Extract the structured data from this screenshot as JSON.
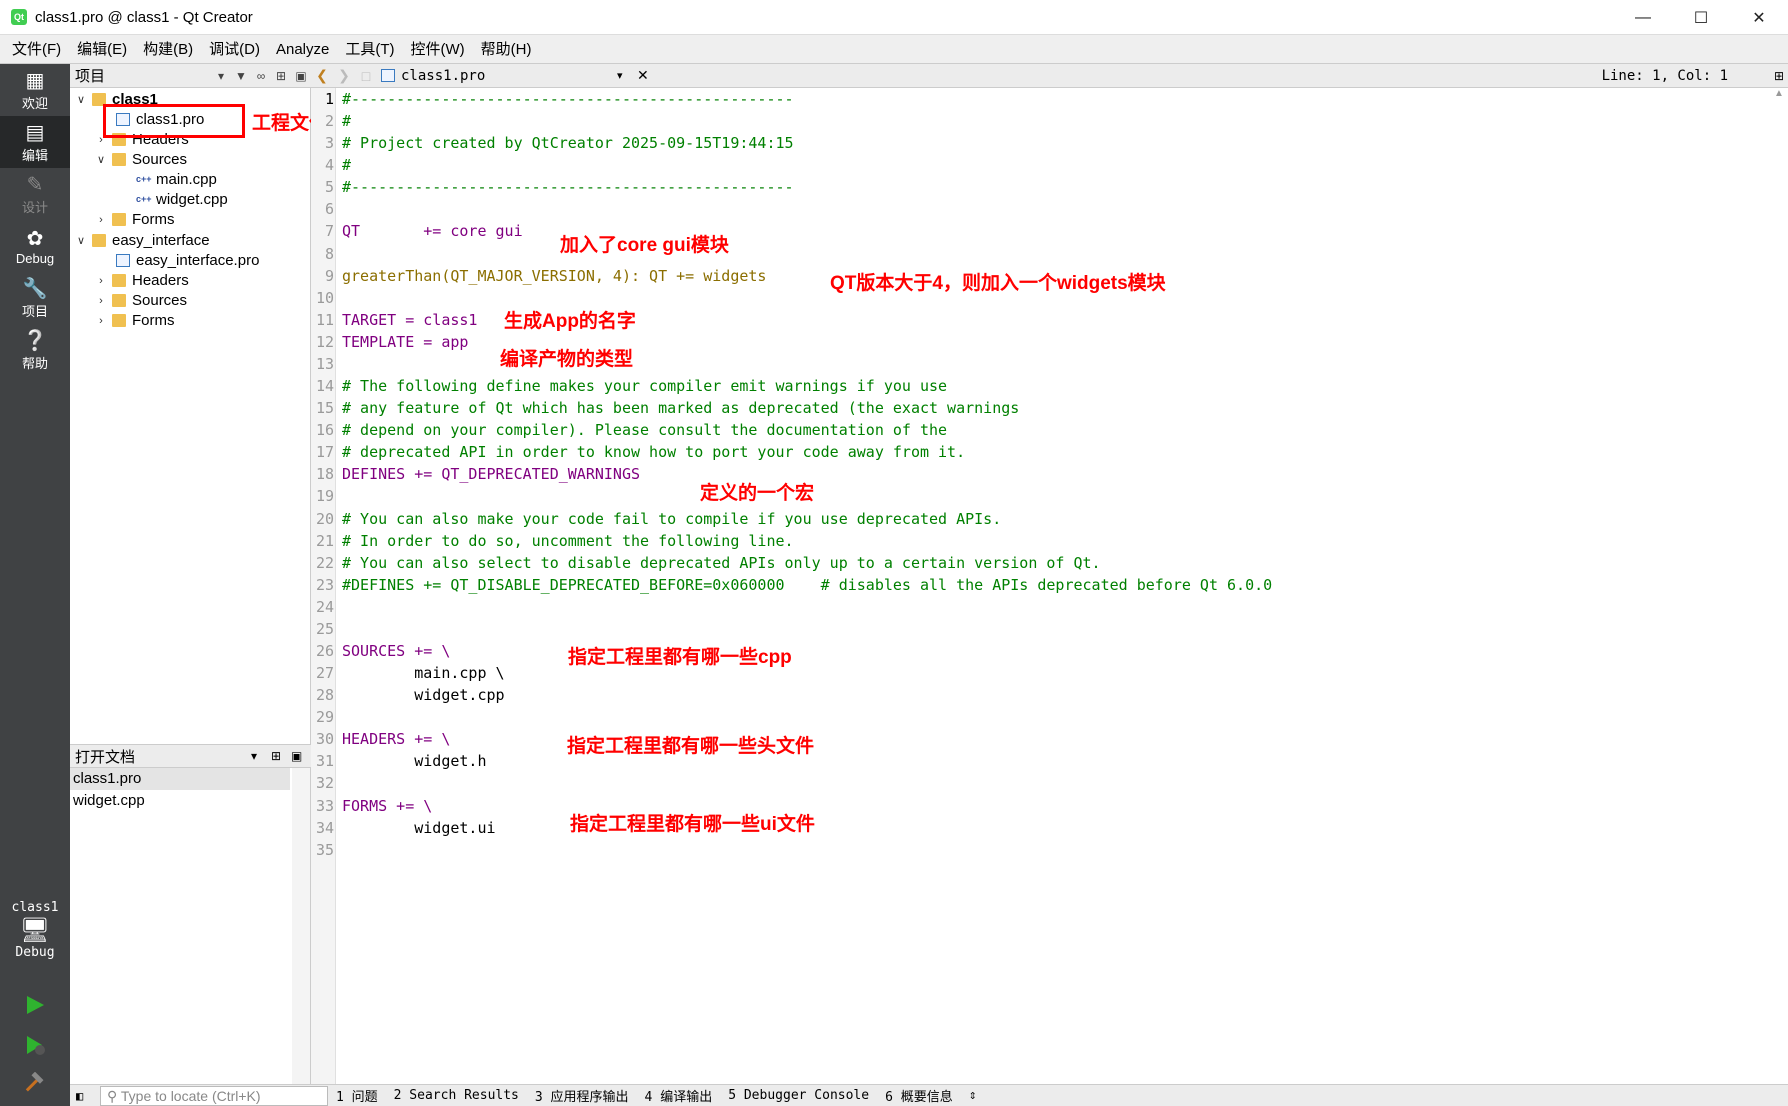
{
  "window": {
    "title": "class1.pro @ class1 - Qt Creator",
    "icon": "qt-creator-icon",
    "controls": [
      "minimize-icon",
      "maximize-icon",
      "close-icon"
    ]
  },
  "menu": [
    "文件(F)",
    "编辑(E)",
    "构建(B)",
    "调试(D)",
    "Analyze",
    "工具(T)",
    "控件(W)",
    "帮助(H)"
  ],
  "sidebar": {
    "modes": [
      {
        "label": "欢迎",
        "icon": "grid-icon"
      },
      {
        "label": "编辑",
        "icon": "edit-icon"
      },
      {
        "label": "设计",
        "icon": "pen-icon"
      },
      {
        "label": "Debug",
        "icon": "bug-icon"
      },
      {
        "label": "项目",
        "icon": "wrench-icon"
      },
      {
        "label": "帮助",
        "icon": "help-icon"
      }
    ],
    "kit_name": "class1",
    "kit_mode": "Debug"
  },
  "project_panel": {
    "header": "项目",
    "tree": [
      {
        "label": "class1",
        "bold": true
      },
      {
        "label": "class1.pro"
      },
      {
        "label": "Headers"
      },
      {
        "label": "Sources"
      },
      {
        "label": "main.cpp"
      },
      {
        "label": "widget.cpp"
      },
      {
        "label": "Forms"
      },
      {
        "label": "easy_interface"
      },
      {
        "label": "easy_interface.pro"
      },
      {
        "label": "Headers"
      },
      {
        "label": "Sources"
      },
      {
        "label": "Forms"
      }
    ]
  },
  "open_docs": {
    "header": "打开文档",
    "items": [
      "class1.pro",
      "widget.cpp"
    ]
  },
  "editor": {
    "file": "class1.pro",
    "position": "Line: 1, Col: 1",
    "line_numbers": [
      "1",
      "2",
      "3",
      "4",
      "5",
      "6",
      "7",
      "8",
      "9",
      "10",
      "11",
      "12",
      "13",
      "14",
      "15",
      "16",
      "17",
      "18",
      "19",
      "20",
      "21",
      "22",
      "23",
      "24",
      "25",
      "26",
      "27",
      "28",
      "29",
      "30",
      "31",
      "32",
      "33",
      "34",
      "35"
    ],
    "lines": [
      "#-------------------------------------------------",
      "#",
      "# Project created by QtCreator 2025-09-15T19:44:15",
      "#",
      "#-------------------------------------------------",
      "",
      "QT       += core gui",
      "",
      "greaterThan(QT_MAJOR_VERSION, 4): QT += widgets",
      "",
      "TARGET = class1",
      "TEMPLATE = app",
      "",
      "# The following define makes your compiler emit warnings if you use",
      "# any feature of Qt which has been marked as deprecated (the exact warnings",
      "# depend on your compiler). Please consult the documentation of the",
      "# deprecated API in order to know how to port your code away from it.",
      "DEFINES += QT_DEPRECATED_WARNINGS",
      "",
      "# You can also make your code fail to compile if you use deprecated APIs.",
      "# In order to do so, uncomment the following line.",
      "# You can also select to disable deprecated APIs only up to a certain version of Qt.",
      "#DEFINES += QT_DISABLE_DEPRECATED_BEFORE=0x060000    # disables all the APIs deprecated before Qt 6.0.0",
      "",
      "",
      "SOURCES += \\",
      "        main.cpp \\",
      "        widget.cpp",
      "",
      "HEADERS += \\",
      "        widget.h",
      "",
      "FORMS += \\",
      "        widget.ui",
      ""
    ]
  },
  "annotations": {
    "project_file": "工程文件",
    "qt": "加入了core gui模块",
    "widgets": "QT版本大于4，则加入一个widgets模块",
    "target": "生成App的名字",
    "template": "编译产物的类型",
    "defines": "定义的一个宏",
    "sources": "指定工程里都有哪一些cpp",
    "headers": "指定工程里都有哪一些头文件",
    "forms": "指定工程里都有哪一些ui文件"
  },
  "statusbar": {
    "locate_placeholder": "Type to locate (Ctrl+K)",
    "panes": [
      "1 问题",
      "2 Search Results",
      "3 应用程序输出",
      "4 编译输出",
      "5 Debugger Console",
      "6 概要信息"
    ]
  },
  "colors": {
    "annotation": "#ff0000",
    "comment": "#008000",
    "keyword": "#800080",
    "function": "#8b6e00",
    "sidebar": "#404244"
  }
}
